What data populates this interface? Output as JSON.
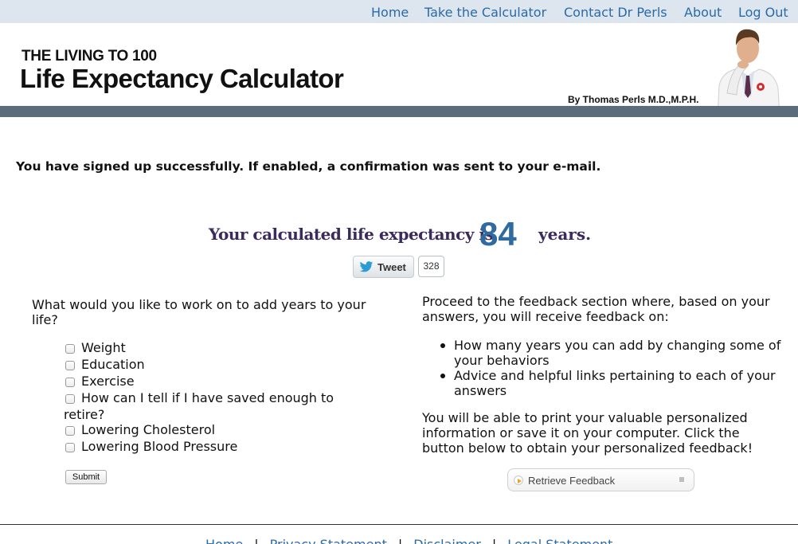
{
  "nav": {
    "home": "Home",
    "take_calculator": "Take the Calculator",
    "contact": "Contact Dr Perls",
    "about": "About",
    "logout": "Log Out"
  },
  "header": {
    "kicker": "THE LIVING TO 100",
    "title": "Life Expectancy Calculator",
    "byline": "By Thomas Perls M.D.,M.P.H."
  },
  "success_message": "You have signed up successfully. If enabled, a confirmation was sent to your e-mail.",
  "result": {
    "prefix": "Your calculated life expectancy is",
    "value": "84",
    "suffix": "years."
  },
  "tweet": {
    "label": "Tweet",
    "count": "328"
  },
  "left": {
    "question": "What would you like to work on to add years to your life?",
    "options": [
      "Weight",
      "Education",
      "Exercise",
      "How can I tell if I have saved enough to",
      "retire?",
      "Lowering Cholesterol",
      "Lowering Blood Pressure"
    ],
    "submit": "Submit"
  },
  "right": {
    "intro": "Proceed to the feedback section where, based on your answers, you will receive feedback on:",
    "bullets": [
      "How many years you can add by changing some of your behaviors",
      "Advice and helpful links pertaining to each of your answers"
    ],
    "outro": "You will be able to print your valuable personalized information or save it on your computer. Click the button below to obtain your personalized feedback!",
    "retrieve": "Retrieve Feedback"
  },
  "footer": {
    "links": [
      "Home",
      "Privacy Statement",
      "Disclaimer",
      "Legal Statement"
    ],
    "separator": "|"
  },
  "colors": {
    "link": "#2a6aa8",
    "nav_bg": "#dde6ee",
    "header_bar": "#5b6d7d",
    "result_text": "#3b2a5c",
    "result_number": "#2f6aa0"
  }
}
